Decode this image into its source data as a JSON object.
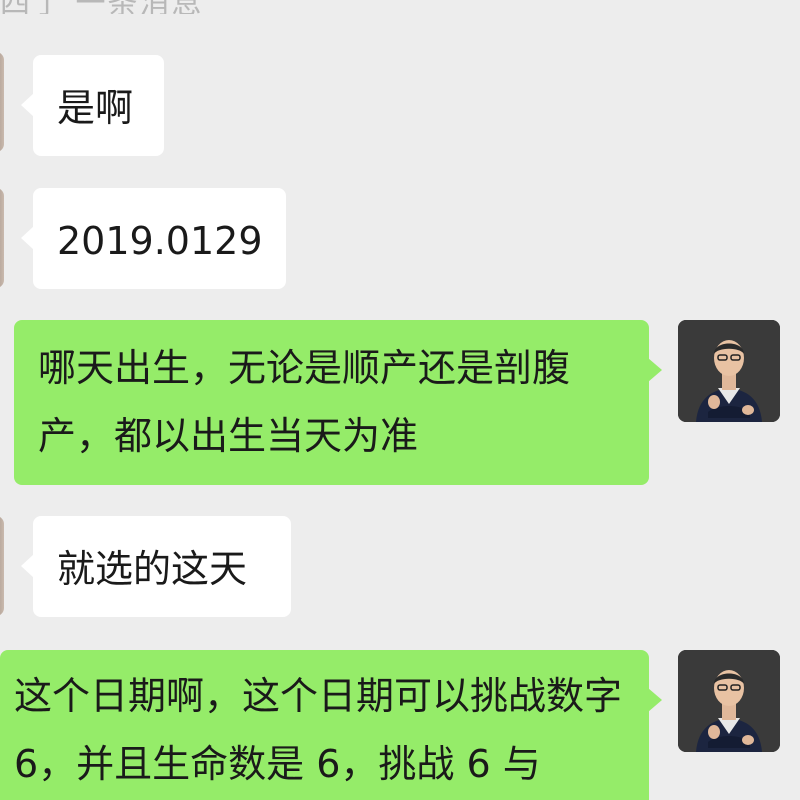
{
  "header": {
    "fragment_text": "四了 一条消息"
  },
  "messages": [
    {
      "side": "left",
      "text": "是啊"
    },
    {
      "side": "left",
      "text": "2019.0129"
    },
    {
      "side": "right",
      "text": "哪天出生，无论是顺产还是剖腹产，都以出生当天为准"
    },
    {
      "side": "left",
      "text": "就选的这天"
    },
    {
      "side": "right",
      "text": "这个日期啊，这个日期可以挑战数字 6，并且生命数是 6，挑战 6 与"
    }
  ],
  "colors": {
    "background": "#ededed",
    "incoming_bubble": "#ffffff",
    "outgoing_bubble": "#95ec69",
    "text": "#1a1a1a"
  }
}
